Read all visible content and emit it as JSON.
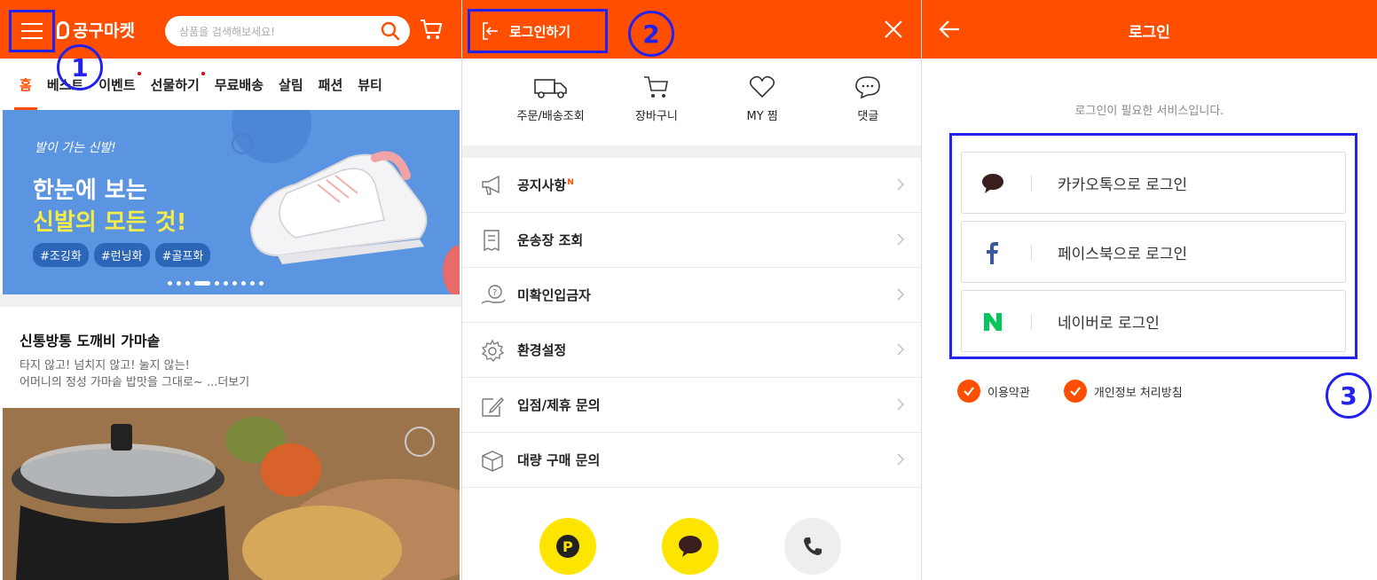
{
  "colors": {
    "brand": "#ff4e00",
    "annotation": "#2222ee",
    "kakao": "#fee500",
    "facebook": "#3b5998",
    "naver": "#03c75a"
  },
  "home": {
    "logo": "공구마켓",
    "search_placeholder": "상품을 검색해보세요!",
    "tabs": [
      {
        "label": "홈",
        "active": true
      },
      {
        "label": "베스트",
        "dot": false
      },
      {
        "label": "이벤트",
        "dot": true
      },
      {
        "label": "선물하기",
        "dot": true
      },
      {
        "label": "무료배송"
      },
      {
        "label": "살림"
      },
      {
        "label": "패션"
      },
      {
        "label": "뷰티"
      }
    ],
    "banner": {
      "handwritten": "발이 가는 신발!",
      "headline1": "한눈에 보는",
      "headline2": "신발의 모든 것!",
      "tags": [
        "#조깅화",
        "#런닝화",
        "#골프화"
      ],
      "slide_count": 10,
      "active_slide": 3
    },
    "article": {
      "title": "신통방통 도깨비 가마솥",
      "desc_line1": "타지 않고! 넘치지 않고! 눌지 않는!",
      "desc_line2": "어머니의 정성 가마솥 밥맛을 그대로~ ...더보기"
    }
  },
  "drawer": {
    "login_label": "로그인하기",
    "quick_links": [
      {
        "label": "주문/배송조회",
        "icon": "truck-icon"
      },
      {
        "label": "장바구니",
        "icon": "cart-icon"
      },
      {
        "label": "MY 찜",
        "icon": "heart-icon"
      },
      {
        "label": "댓글",
        "icon": "speech-bubble-icon"
      }
    ],
    "menu": [
      {
        "label": "공지사항",
        "badge": "N",
        "icon": "megaphone-icon"
      },
      {
        "label": "운송장 조회",
        "icon": "receipt-icon"
      },
      {
        "label": "미확인입금자",
        "icon": "hand-question-icon"
      },
      {
        "label": "환경설정",
        "icon": "gear-icon"
      },
      {
        "label": "입점/제휴 문의",
        "icon": "pencil-note-icon"
      },
      {
        "label": "대량 구매 문의",
        "icon": "box-icon"
      }
    ],
    "bottom_buttons": [
      "kakao-pay-icon",
      "kakao-talk-icon",
      "phone-icon"
    ]
  },
  "login": {
    "title": "로그인",
    "note": "로그인이 필요한 서비스입니다.",
    "social": [
      {
        "label": "카카오톡으로 로그인",
        "icon": "kakao-icon"
      },
      {
        "label": "페이스북으로 로그인",
        "icon": "facebook-icon"
      },
      {
        "label": "네이버로 로그인",
        "icon": "naver-icon"
      }
    ],
    "checks": [
      "이용약관",
      "개인정보 처리방침"
    ]
  },
  "annotations": [
    "1",
    "2",
    "3"
  ]
}
